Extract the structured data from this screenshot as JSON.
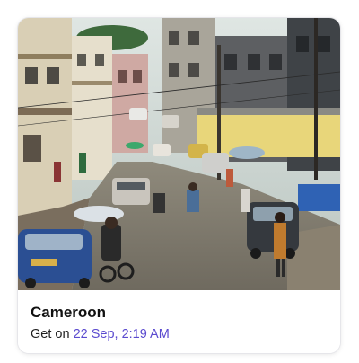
{
  "card": {
    "image_alt": "Busy street scene with people, motorcycles and cars between colorful buildings",
    "title": "Cameroon",
    "prefix": "Get on",
    "date_label": "22 Sep, 2:19 AM"
  },
  "colors": {
    "accent": "#5b4bcf",
    "title_text": "#111111",
    "border": "#e6e6ea"
  }
}
